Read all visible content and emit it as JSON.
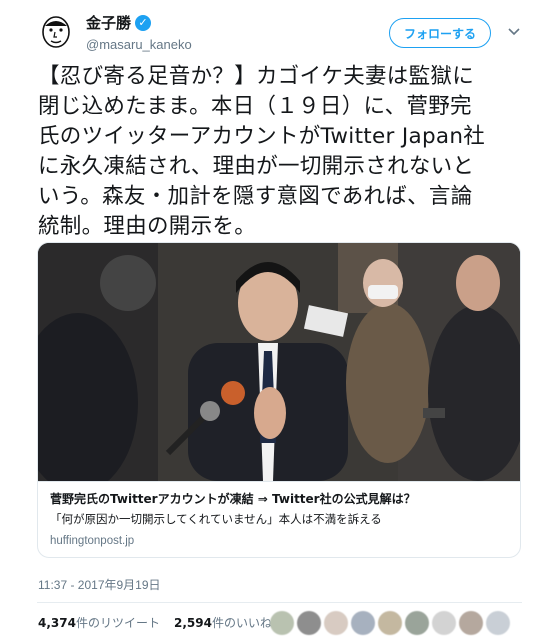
{
  "header": {
    "display_name": "金子勝",
    "handle": "@masaru_kaneko",
    "follow_label": "フォローする"
  },
  "tweet": {
    "text": "【忍び寄る足音か？】カゴイケ夫妻は監獄に\n閉じ込めたまま。本日（１９日）に、菅野完\n氏のツイッターアカウントがTwitter Japan社\nに永久凍結され、理由が一切開示されないと\nいう。森友・加計を隠す意図であれば、言論\n統制。理由の開示を。"
  },
  "card": {
    "title": "菅野完氏のTwitterアカウントが凍結 ⇒ Twitter社の公式見解は？",
    "description": "「何が原因か一切開示してくれていません」本人は不満を訴える",
    "domain": "huffingtonpost.jp"
  },
  "timestamp": "11:37 - 2017年9月19日",
  "stats": {
    "retweets": "4,374",
    "retweets_label": "件のリツイート",
    "likes": "2,594",
    "likes_label": "件のいいね"
  },
  "colors": {
    "accent": "#1da1f2",
    "text": "#14171a",
    "muted": "#657786"
  }
}
